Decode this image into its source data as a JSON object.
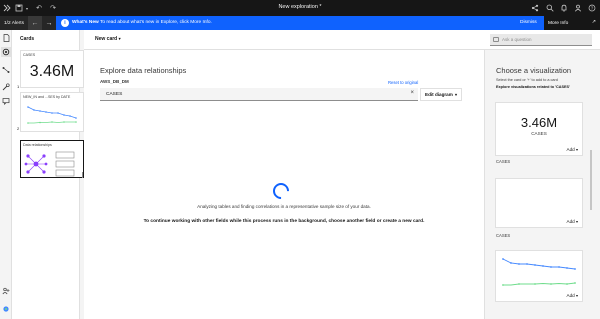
{
  "topbar": {
    "title": "New exploration *"
  },
  "notify": {
    "alerts": "1/2 Alerts",
    "whats_new": "What's New",
    "message": "To read about what's new in Explore, click More Info.",
    "dismiss": "Dismiss",
    "more_info": "More Info"
  },
  "cards_panel": {
    "title": "Cards",
    "items": [
      {
        "label": "CASES",
        "value": "3.46M",
        "number": "1"
      },
      {
        "label": "NEW_IN and ...SES by DATE",
        "number": "2"
      },
      {
        "label": "Data relationships"
      }
    ]
  },
  "toolbar": {
    "new_card": "New card",
    "question_placeholder": "Ask a question"
  },
  "main": {
    "heading": "Explore data relationships",
    "dataset": "AWS_DB_DM",
    "reset": "Reset to original",
    "field_value": "CASES",
    "edit_diagram": "Edit diagram",
    "analyzing": "Analyzing tables and finding correlations in a representative sample size of your data.",
    "continue": "To continue working with other fields while this process runs in the background, choose another field or create a new card."
  },
  "right": {
    "heading": "Choose a visualization",
    "sub1": "Select the card or '+' to add to a card",
    "sub2": "Explore visualizations related to 'CASES'",
    "cards": [
      {
        "value": "3.46M",
        "label": "CASES",
        "add": "Add",
        "caption": "CASES"
      },
      {
        "add": "Add",
        "caption": "CASES"
      },
      {
        "add": "Add"
      }
    ]
  },
  "colors": {
    "accent": "#0f62fe",
    "dark": "#161616",
    "line_blue": "#4589ff",
    "line_green": "#6fdc8c"
  }
}
